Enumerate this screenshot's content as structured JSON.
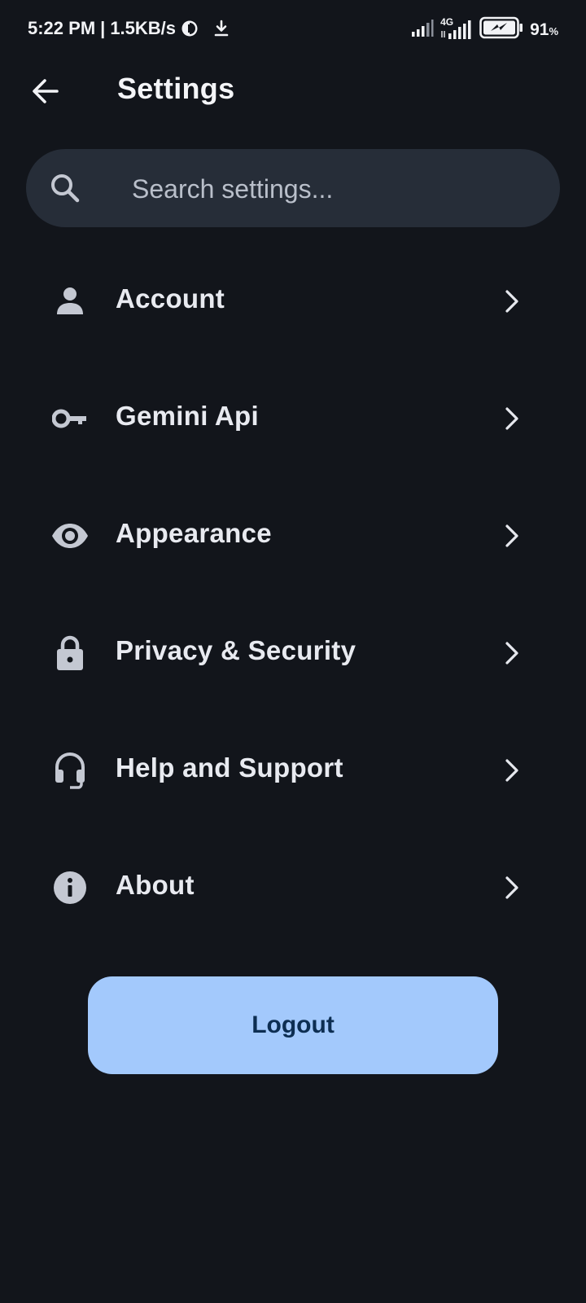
{
  "status_bar": {
    "time": "5:22 PM",
    "separator": "|",
    "net_speed": "1.5KB/s",
    "network_type": "4G",
    "battery_level": "91",
    "battery_unit": "%"
  },
  "header": {
    "title": "Settings",
    "back_icon": "arrow-left-icon"
  },
  "search": {
    "placeholder": "Search settings...",
    "value": "",
    "icon": "search-icon"
  },
  "settings": {
    "items": [
      {
        "label": "Account",
        "icon": "person-icon"
      },
      {
        "label": "Gemini Api",
        "icon": "key-icon"
      },
      {
        "label": "Appearance",
        "icon": "eye-icon"
      },
      {
        "label": "Privacy & Security",
        "icon": "lock-icon"
      },
      {
        "label": "Help and Support",
        "icon": "headset-icon"
      },
      {
        "label": "About",
        "icon": "info-icon"
      }
    ]
  },
  "logout": {
    "label": "Logout"
  },
  "colors": {
    "background": "#12151b",
    "search_bg": "#262d38",
    "logout_bg": "#a3c9fc",
    "logout_text": "#0d2e52",
    "icon": "#c4c8d2"
  }
}
